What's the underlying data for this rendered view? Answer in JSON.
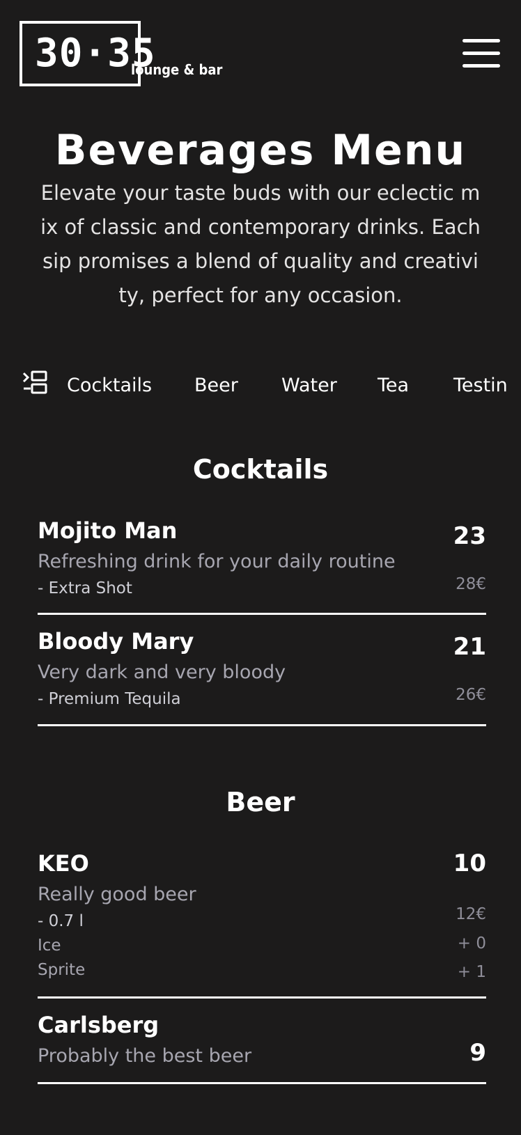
{
  "brand": {
    "logo_number": "30·35",
    "logo_sub": "lounge & bar"
  },
  "header": {
    "menu_icon": "hamburger-menu-icon"
  },
  "page": {
    "title": "Beverages Menu",
    "intro": "Elevate your taste buds with our eclectic mix of classic and contemporary drinks. Each sip promises a blend of quality and creativity, perfect for any occasion."
  },
  "tabs": {
    "icon": "list-indent-icon",
    "items": [
      "Cocktails",
      "Beer",
      "Water",
      "Tea",
      "Testin"
    ]
  },
  "sections": [
    {
      "title": "Cocktails",
      "items": [
        {
          "name": "Mojito Man",
          "price": "23",
          "description": "Refreshing drink for your daily routine",
          "options": [
            {
              "label": "- Extra Shot",
              "price": "28€"
            }
          ]
        },
        {
          "name": "Bloody Mary",
          "price": "21",
          "description": "Very dark and very bloody",
          "options": [
            {
              "label": "- Premium Tequila",
              "price": "26€"
            }
          ]
        }
      ]
    },
    {
      "title": "Beer",
      "items": [
        {
          "name": "KEO",
          "price": "10",
          "description": "Really good beer",
          "options": [
            {
              "label": "- 0.7 l",
              "price": "12€"
            },
            {
              "label": "Ice",
              "price": "+ 0"
            },
            {
              "label": "Sprite",
              "price": "+ 1"
            }
          ]
        },
        {
          "name": "Carlsberg",
          "price": "9",
          "description": "Probably the best beer",
          "options": []
        }
      ]
    }
  ]
}
